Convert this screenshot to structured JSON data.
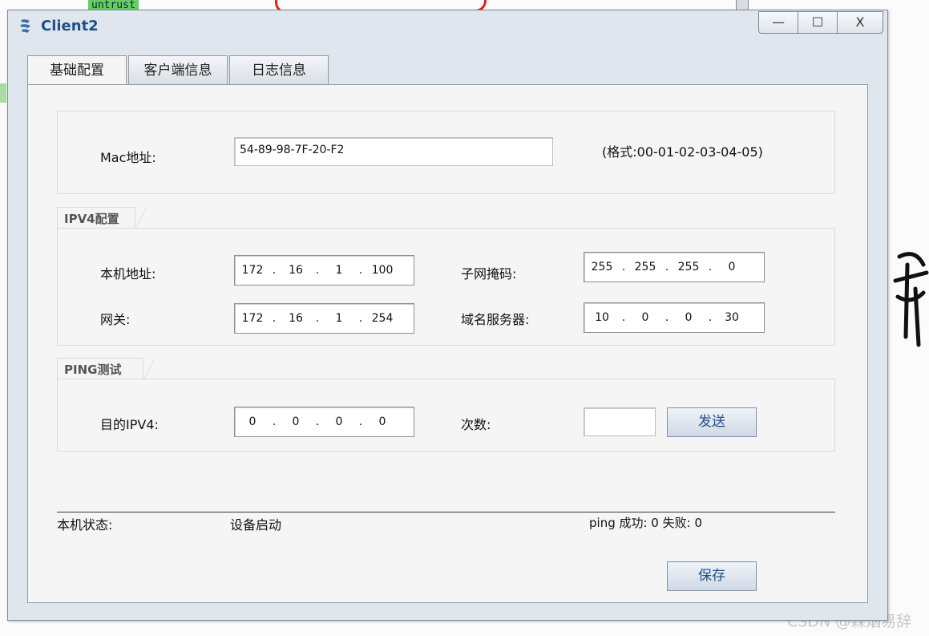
{
  "background": {
    "zone_label": "untrust",
    "watermark": "CSDN @霖烟易辞"
  },
  "window": {
    "title": "Client2",
    "controls": {
      "minimize": "—",
      "maximize": "☐",
      "close": "X"
    }
  },
  "tabs": [
    {
      "label": "基础配置",
      "active": true
    },
    {
      "label": "客户端信息",
      "active": false
    },
    {
      "label": "日志信息",
      "active": false
    }
  ],
  "mac": {
    "label": "Mac地址:",
    "value": "54-89-98-7F-20-F2",
    "format_hint": "(格式:00-01-02-03-04-05)"
  },
  "ipv4": {
    "group_title": "IPV4配置",
    "local_ip": {
      "label": "本机地址:",
      "octets": [
        "172",
        "16",
        "1",
        "100"
      ]
    },
    "subnet_mask": {
      "label": "子网掩码:",
      "octets": [
        "255",
        "255",
        "255",
        "0"
      ]
    },
    "gateway": {
      "label": "网关:",
      "octets": [
        "172",
        "16",
        "1",
        "254"
      ]
    },
    "dns": {
      "label": "域名服务器:",
      "octets": [
        "10",
        "0",
        "0",
        "30"
      ]
    }
  },
  "ping": {
    "group_title": "PING测试",
    "dest": {
      "label": "目的IPV4:",
      "octets": [
        "0",
        "0",
        "0",
        "0"
      ]
    },
    "count": {
      "label": "次数:",
      "value": ""
    },
    "send_label": "发送"
  },
  "status": {
    "label": "本机状态:",
    "value": "设备启动",
    "ping_result": "ping 成功: 0 失败: 0"
  },
  "save_label": "保存",
  "colors": {
    "title": "#1f4f86",
    "window_frame": "#dfe6ee",
    "panel": "#f5f5f5"
  }
}
